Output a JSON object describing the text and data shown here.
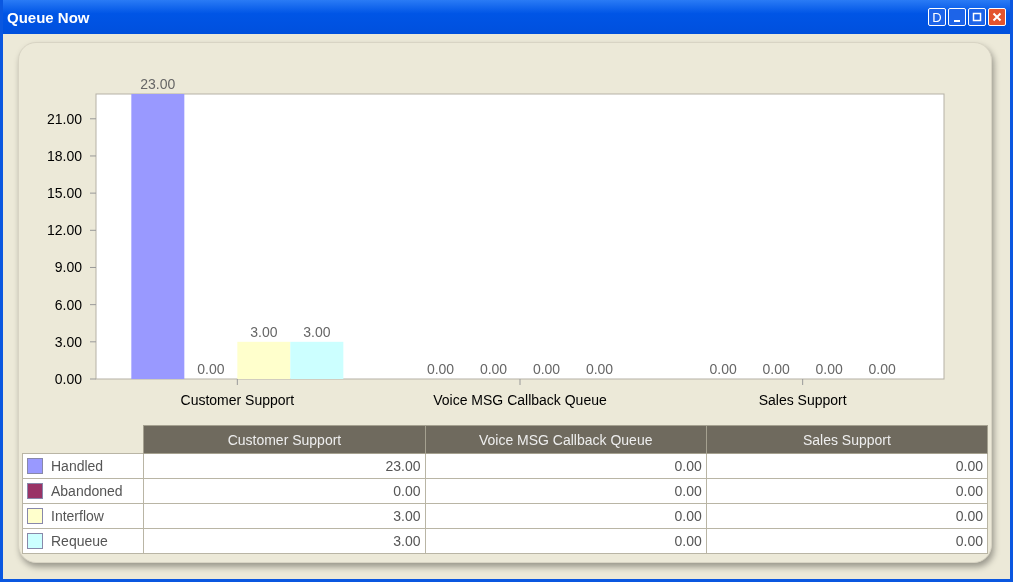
{
  "window": {
    "title": "Queue Now"
  },
  "title_buttons": [
    {
      "kind": "text",
      "label": "D"
    },
    {
      "kind": "minimize"
    },
    {
      "kind": "maximize"
    },
    {
      "kind": "close"
    }
  ],
  "chart_data": {
    "type": "bar",
    "categories": [
      "Customer Support",
      "Voice MSG Callback Queue",
      "Sales Support"
    ],
    "series": [
      {
        "name": "Handled",
        "color": "#9999ff",
        "values": [
          23,
          0,
          0
        ]
      },
      {
        "name": "Abandoned",
        "color": "#993366",
        "values": [
          0,
          0,
          0
        ]
      },
      {
        "name": "Interflow",
        "color": "#ffffcc",
        "values": [
          3,
          0,
          0
        ]
      },
      {
        "name": "Requeue",
        "color": "#ccffff",
        "values": [
          3,
          0,
          0
        ]
      }
    ],
    "ylim": [
      0,
      23
    ],
    "yticks": [
      {
        "value": 0,
        "label": "0.00"
      },
      {
        "value": 3,
        "label": "3.00"
      },
      {
        "value": 6,
        "label": "6.00"
      },
      {
        "value": 9,
        "label": "9.00"
      },
      {
        "value": 12,
        "label": "12.00"
      },
      {
        "value": 15,
        "label": "15.00"
      },
      {
        "value": 18,
        "label": "18.00"
      },
      {
        "value": 21,
        "label": "21.00"
      }
    ],
    "value_labels": [
      [
        "23.00",
        "0.00",
        "0.00"
      ],
      [
        "0.00",
        "0.00",
        "0.00"
      ],
      [
        "3.00",
        "0.00",
        "0.00"
      ],
      [
        "3.00",
        "0.00",
        "0.00"
      ]
    ]
  },
  "table": {
    "columns": [
      "Customer Support",
      "Voice MSG Callback Queue",
      "Sales Support"
    ],
    "rows": [
      {
        "values": [
          "23.00",
          "0.00",
          "0.00"
        ]
      },
      {
        "values": [
          "0.00",
          "0.00",
          "0.00"
        ]
      },
      {
        "values": [
          "3.00",
          "0.00",
          "0.00"
        ]
      },
      {
        "values": [
          "3.00",
          "0.00",
          "0.00"
        ]
      }
    ]
  }
}
